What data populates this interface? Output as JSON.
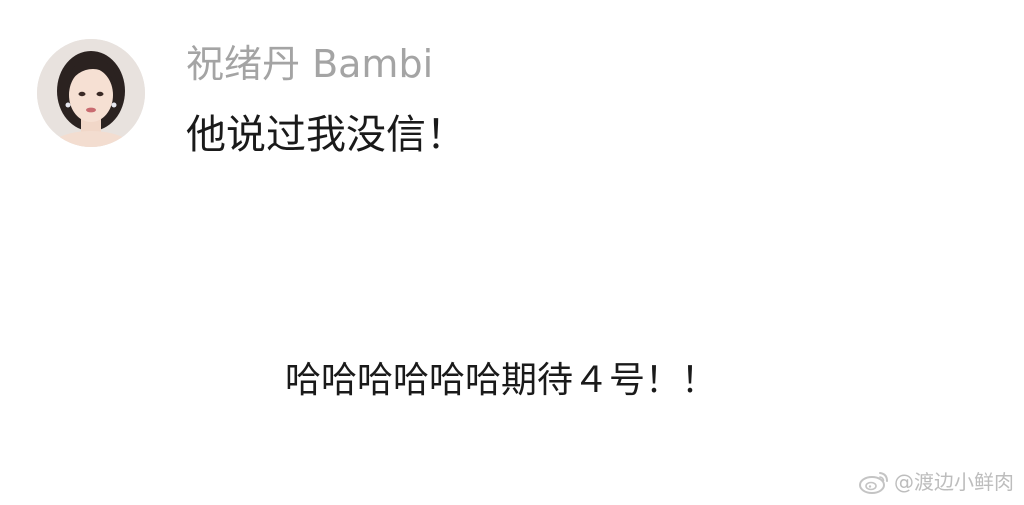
{
  "comment": {
    "username": "祝绪丹 Bambi",
    "text": "他说过我没信！"
  },
  "reply": {
    "text": "哈哈哈哈哈哈期待４号！！"
  },
  "watermark": {
    "text": "@渡边小鲜肉",
    "icon": "weibo-logo-icon"
  }
}
